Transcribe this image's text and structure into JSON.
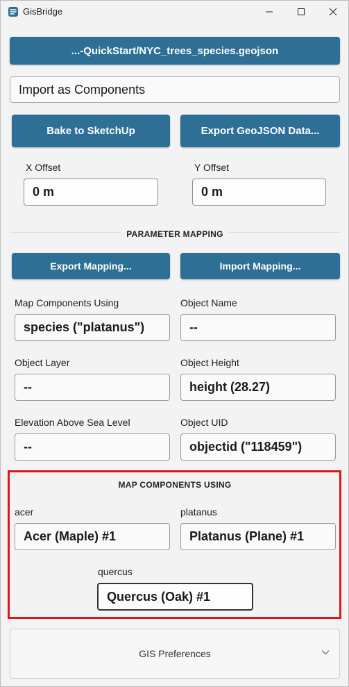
{
  "window": {
    "title": "GisBridge",
    "controls": {
      "minimize": "minimize-icon",
      "maximize": "maximize-icon",
      "close": "close-icon"
    }
  },
  "file_button": {
    "label": "...-QuickStart/NYC_trees_species.geojson"
  },
  "import_mode": {
    "value": "Import as Components"
  },
  "actions": {
    "bake": "Bake to SketchUp",
    "export_geojson": "Export GeoJSON Data..."
  },
  "offsets": {
    "x": {
      "label": "X Offset",
      "value": "0 m"
    },
    "y": {
      "label": "Y Offset",
      "value": "0 m"
    }
  },
  "parameter_mapping": {
    "title": "PARAMETER MAPPING",
    "export_button": "Export Mapping...",
    "import_button": "Import Mapping...",
    "fields": {
      "map_components": {
        "label": "Map Components Using",
        "value": "species (\"platanus\")"
      },
      "object_name": {
        "label": "Object Name",
        "value": "--"
      },
      "object_layer": {
        "label": "Object Layer",
        "value": "--"
      },
      "object_height": {
        "label": "Object Height",
        "value": "height (28.27)"
      },
      "elevation": {
        "label": "Elevation Above Sea Level",
        "value": "--"
      },
      "object_uid": {
        "label": "Object UID",
        "value": "objectid (\"118459\")"
      }
    }
  },
  "map_components": {
    "title": "MAP COMPONENTS USING",
    "acer": {
      "label": "acer",
      "value": "Acer (Maple) #1"
    },
    "platanus": {
      "label": "platanus",
      "value": "Platanus (Plane) #1"
    },
    "quercus": {
      "label": "quercus",
      "value": "Quercus (Oak) #1"
    }
  },
  "preferences": {
    "label": "GIS Preferences"
  },
  "colors": {
    "accent": "#2e6f95",
    "highlight": "#e0141b"
  }
}
